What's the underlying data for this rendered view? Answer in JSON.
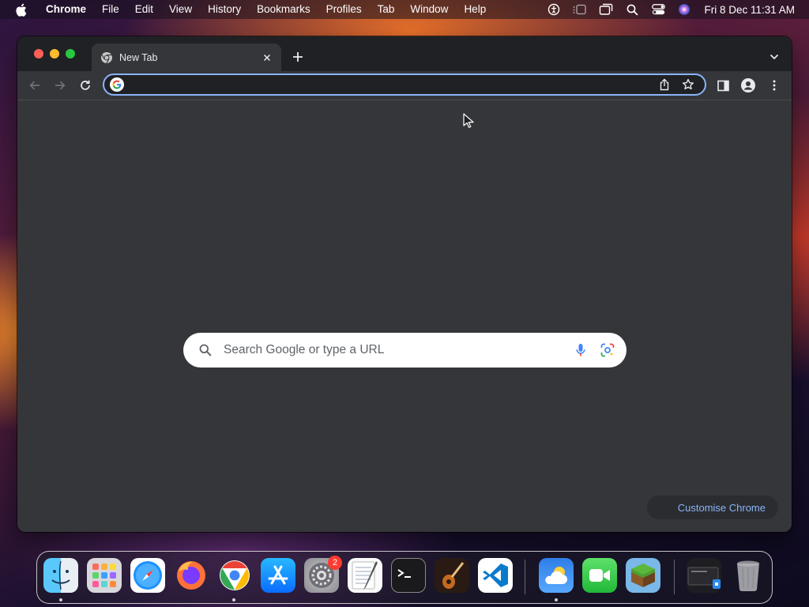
{
  "menubar": {
    "app_name": "Chrome",
    "menus": [
      "File",
      "Edit",
      "View",
      "History",
      "Bookmarks",
      "Profiles",
      "Tab",
      "Window",
      "Help"
    ],
    "clock": "Fri 8 Dec  11:31 AM",
    "status_icons": [
      "accessibility-icon",
      "stage-manager-icon",
      "screen-mirroring-icon",
      "spotlight-icon",
      "control-center-icon",
      "siri-icon"
    ]
  },
  "browser": {
    "tab": {
      "title": "New Tab"
    },
    "omnibox": {
      "value": "",
      "placeholder": ""
    },
    "ntp": {
      "search_placeholder": "Search Google or type a URL",
      "customise_label": "Customise Chrome"
    }
  },
  "dock": {
    "apps": [
      "Finder",
      "Launchpad",
      "Safari",
      "Firefox",
      "Google Chrome",
      "App Store",
      "System Settings",
      "TextEdit",
      "Terminal",
      "GarageBand",
      "Visual Studio Code",
      "Weather",
      "FaceTime",
      "Minecraft",
      "Downloads",
      "Trash"
    ],
    "system_settings_badge": "2"
  },
  "colors": {
    "window_bg": "#35363a",
    "titlebar_bg": "#202124",
    "accent": "#8ab4f8",
    "text": "#e8eaed"
  }
}
